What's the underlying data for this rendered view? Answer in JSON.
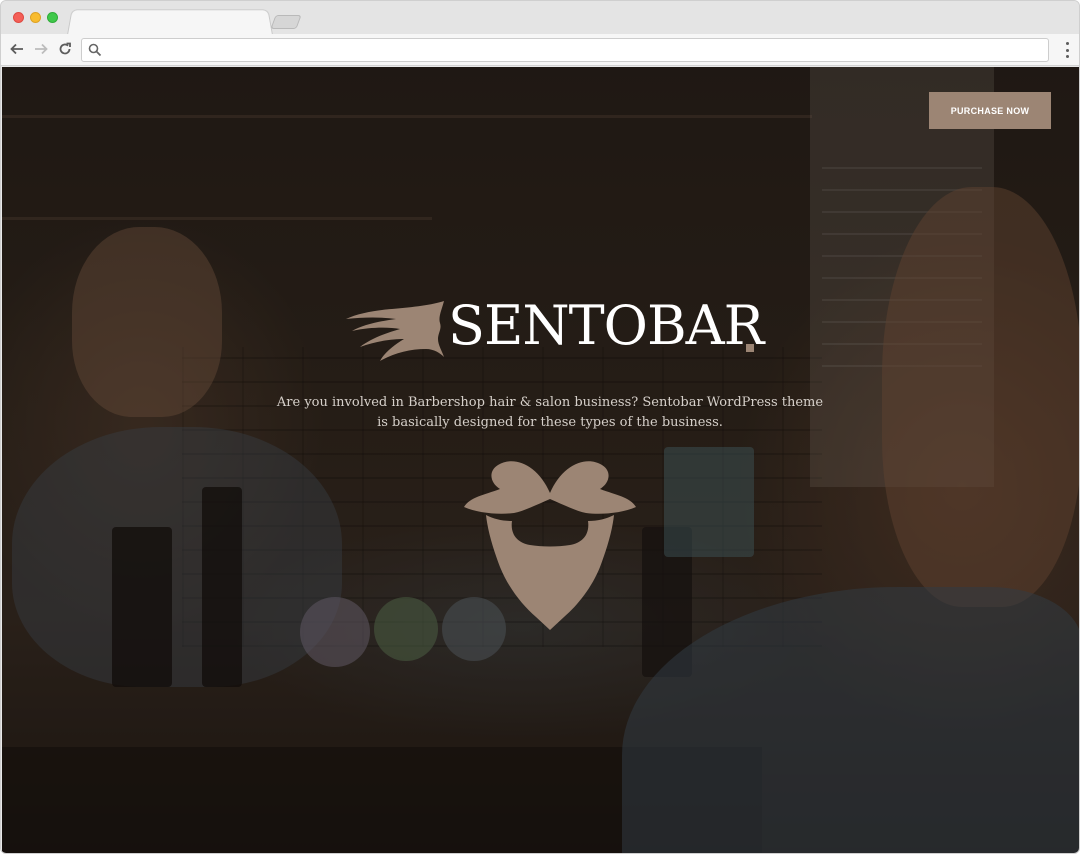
{
  "browser": {
    "address": ""
  },
  "hero": {
    "purchase_label": "PURCHASE NOW",
    "brand_name": "SENTOBAR",
    "tagline_line1": "Are you involved in Barbershop hair & salon business? Sentobar WordPress theme",
    "tagline_line2": "is basically designed for these types of the business."
  },
  "colors": {
    "accent": "#9c8574",
    "text_light": "#d6d0ca"
  },
  "icons": [
    "search-icon",
    "back-arrow-icon",
    "forward-arrow-icon",
    "reload-icon",
    "menu-dots-icon",
    "hair-logo-icon",
    "mustache-beard-icon"
  ]
}
